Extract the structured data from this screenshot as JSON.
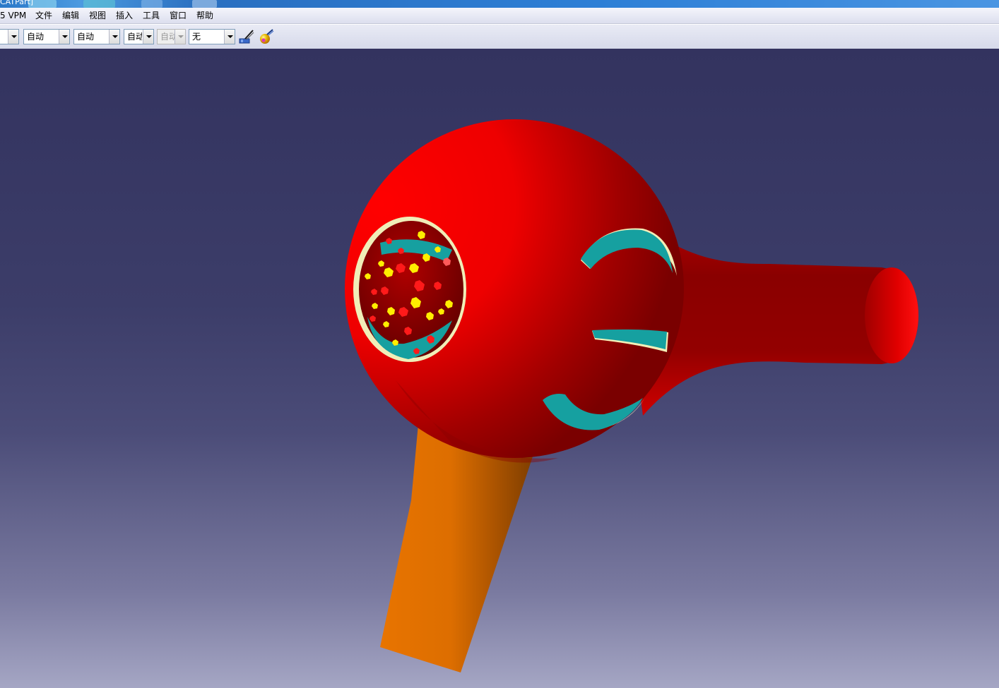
{
  "window": {
    "title": "CATPart]"
  },
  "menubar": {
    "items": [
      {
        "id": "vpm",
        "label": "5 VPM"
      },
      {
        "id": "file",
        "label": "文件"
      },
      {
        "id": "edit",
        "label": "编辑"
      },
      {
        "id": "view",
        "label": "视图"
      },
      {
        "id": "insert",
        "label": "插入"
      },
      {
        "id": "tools",
        "label": "工具"
      },
      {
        "id": "window",
        "label": "窗口"
      },
      {
        "id": "help",
        "label": "帮助"
      }
    ]
  },
  "toolbar": {
    "combos": [
      {
        "id": "combo-0",
        "value": "",
        "enabled": true
      },
      {
        "id": "combo-1",
        "value": "自动",
        "enabled": true
      },
      {
        "id": "combo-2",
        "value": "自动",
        "enabled": true
      },
      {
        "id": "combo-3",
        "value": "自动",
        "enabled": true
      },
      {
        "id": "combo-4",
        "value": "自动",
        "enabled": false
      },
      {
        "id": "combo-5",
        "value": "无",
        "enabled": true
      }
    ],
    "icons": [
      "paint-brush-icon",
      "material-sphere-icon"
    ]
  },
  "viewport": {
    "background_top": "#33335f",
    "background_bottom": "#a5a6c4",
    "model": {
      "name": "hair-dryer",
      "body_color": "#e60000",
      "handle_color": "#e07000",
      "vent_color": "#16a0a0",
      "vent_rim_color": "#f2efb8",
      "dot_colors": [
        "#ffee00",
        "#ff1a1a"
      ]
    }
  }
}
